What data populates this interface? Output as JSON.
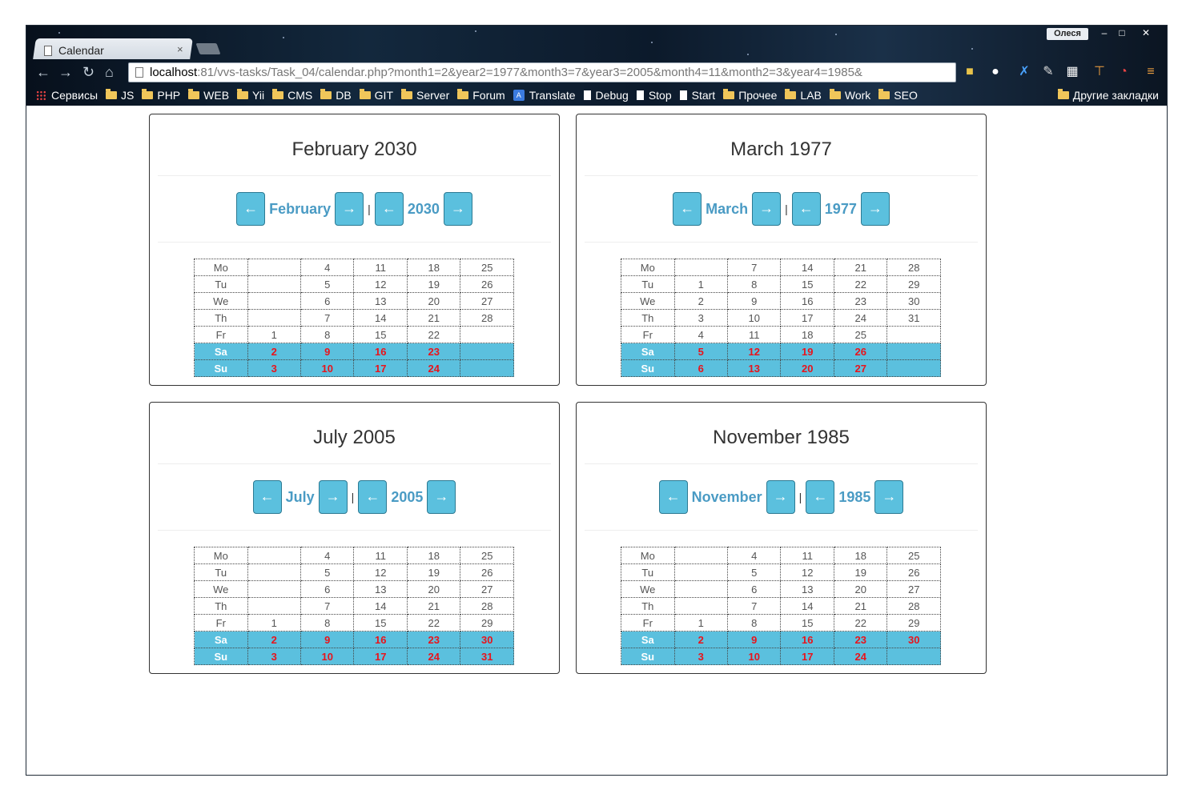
{
  "browser": {
    "tab_title": "Calendar",
    "tab_close": "×",
    "profile_name": "Олеся",
    "window_controls": [
      "–",
      "□",
      "✕"
    ],
    "url_host": "localhost",
    "url_rest": ":81/vvs-tasks/Task_04/calendar.php?month1=2&year2=1977&month3=7&year3=2005&month4=11&month2=3&year4=1985&",
    "bookmarks": [
      "Сервисы",
      "JS",
      "PHP",
      "WEB",
      "Yii",
      "CMS",
      "DB",
      "GIT",
      "Server",
      "Forum",
      "Translate",
      "Debug",
      "Stop",
      "Start",
      "Прочее",
      "LAB",
      "Work",
      "SEO"
    ],
    "other_bookmarks": "Другие закладки"
  },
  "nav_arrows": {
    "prev": "←",
    "next": "→",
    "separator": "|"
  },
  "calendars": [
    {
      "title": "February 2030",
      "month": "February",
      "year": "2030",
      "rows": [
        [
          "Mo",
          "",
          "4",
          "11",
          "18",
          "25"
        ],
        [
          "Tu",
          "",
          "5",
          "12",
          "19",
          "26"
        ],
        [
          "We",
          "",
          "6",
          "13",
          "20",
          "27"
        ],
        [
          "Th",
          "",
          "7",
          "14",
          "21",
          "28"
        ],
        [
          "Fr",
          "1",
          "8",
          "15",
          "22",
          ""
        ],
        [
          "Sa",
          "2",
          "9",
          "16",
          "23",
          ""
        ],
        [
          "Su",
          "3",
          "10",
          "17",
          "24",
          ""
        ]
      ]
    },
    {
      "title": "March 1977",
      "month": "March",
      "year": "1977",
      "rows": [
        [
          "Mo",
          "",
          "7",
          "14",
          "21",
          "28"
        ],
        [
          "Tu",
          "1",
          "8",
          "15",
          "22",
          "29"
        ],
        [
          "We",
          "2",
          "9",
          "16",
          "23",
          "30"
        ],
        [
          "Th",
          "3",
          "10",
          "17",
          "24",
          "31"
        ],
        [
          "Fr",
          "4",
          "11",
          "18",
          "25",
          ""
        ],
        [
          "Sa",
          "5",
          "12",
          "19",
          "26",
          ""
        ],
        [
          "Su",
          "6",
          "13",
          "20",
          "27",
          ""
        ]
      ]
    },
    {
      "title": "July 2005",
      "month": "July",
      "year": "2005",
      "rows": [
        [
          "Mo",
          "",
          "4",
          "11",
          "18",
          "25"
        ],
        [
          "Tu",
          "",
          "5",
          "12",
          "19",
          "26"
        ],
        [
          "We",
          "",
          "6",
          "13",
          "20",
          "27"
        ],
        [
          "Th",
          "",
          "7",
          "14",
          "21",
          "28"
        ],
        [
          "Fr",
          "1",
          "8",
          "15",
          "22",
          "29"
        ],
        [
          "Sa",
          "2",
          "9",
          "16",
          "23",
          "30"
        ],
        [
          "Su",
          "3",
          "10",
          "17",
          "24",
          "31"
        ]
      ]
    },
    {
      "title": "November 1985",
      "month": "November",
      "year": "1985",
      "rows": [
        [
          "Mo",
          "",
          "4",
          "11",
          "18",
          "25"
        ],
        [
          "Tu",
          "",
          "5",
          "12",
          "19",
          "26"
        ],
        [
          "We",
          "",
          "6",
          "13",
          "20",
          "27"
        ],
        [
          "Th",
          "",
          "7",
          "14",
          "21",
          "28"
        ],
        [
          "Fr",
          "1",
          "8",
          "15",
          "22",
          "29"
        ],
        [
          "Sa",
          "2",
          "9",
          "16",
          "23",
          "30"
        ],
        [
          "Su",
          "3",
          "10",
          "17",
          "24",
          ""
        ]
      ]
    }
  ]
}
